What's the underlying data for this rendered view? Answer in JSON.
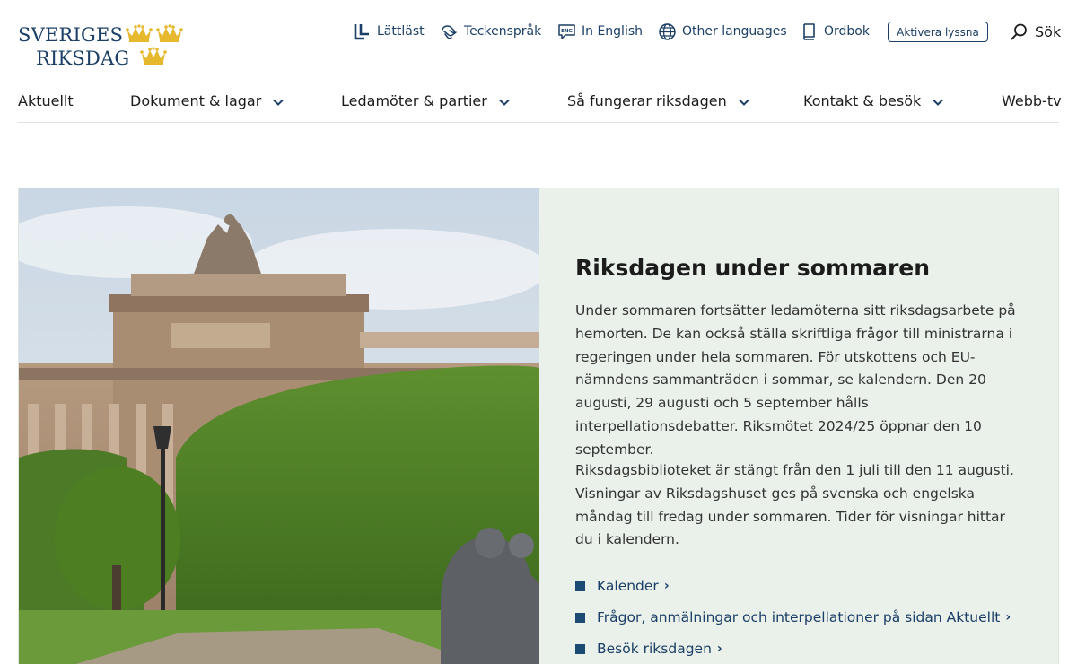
{
  "logo": {
    "line1": "SVERIGES",
    "line2": "RIKSDAG",
    "crown_color": "#e6b82e",
    "text_color": "#1b3f66"
  },
  "utility_nav": {
    "easy_read": {
      "label": "Lättläst",
      "icon": "easy-read-icon"
    },
    "sign_language": {
      "label": "Teckenspråk",
      "icon": "sign-language-icon"
    },
    "english": {
      "label": "In English",
      "icon": "english-icon"
    },
    "other_languages": {
      "label": "Other languages",
      "icon": "globe-icon"
    },
    "dictionary": {
      "label": "Ordbok",
      "icon": "book-icon"
    },
    "listen_button": "Aktivera lyssna",
    "search": {
      "label": "Sök",
      "icon": "search-icon"
    }
  },
  "main_nav": [
    {
      "label": "Aktuellt",
      "has_dropdown": false
    },
    {
      "label": "Dokument & lagar",
      "has_dropdown": true
    },
    {
      "label": "Ledamöter & partier",
      "has_dropdown": true
    },
    {
      "label": "Så fungerar riksdagen",
      "has_dropdown": true
    },
    {
      "label": "Kontakt & besök",
      "has_dropdown": true
    },
    {
      "label": "Webb-tv",
      "has_dropdown": false
    }
  ],
  "hero": {
    "title": "Riksdagen under sommaren",
    "paragraph1": "Under sommaren fortsätter ledamöterna sitt riksdagsarbete på hemorten. De kan också ställa skriftliga frågor till ministrarna i regeringen under hela sommaren. För utskottens och EU-nämndens sammanträden i sommar, se kalendern. Den 20 augusti, 29 augusti och 5 september hålls interpellationsdebatter. Riksmötet 2024/25 öppnar den 10 september.",
    "paragraph2": "Riksdagsbiblioteket är stängt från den 1 juli till den 11 augusti. Visningar av Riksdagshuset ges på svenska och engelska måndag till fredag under sommaren. Tider för visningar hittar du i kalendern.",
    "links": [
      {
        "label": "Kalender"
      },
      {
        "label": "Frågor, anmälningar och interpellationer på sidan Aktuellt"
      },
      {
        "label": "Besök riksdagen"
      }
    ],
    "panel_background": "#eaf0ea",
    "link_color": "#1b3f66"
  }
}
